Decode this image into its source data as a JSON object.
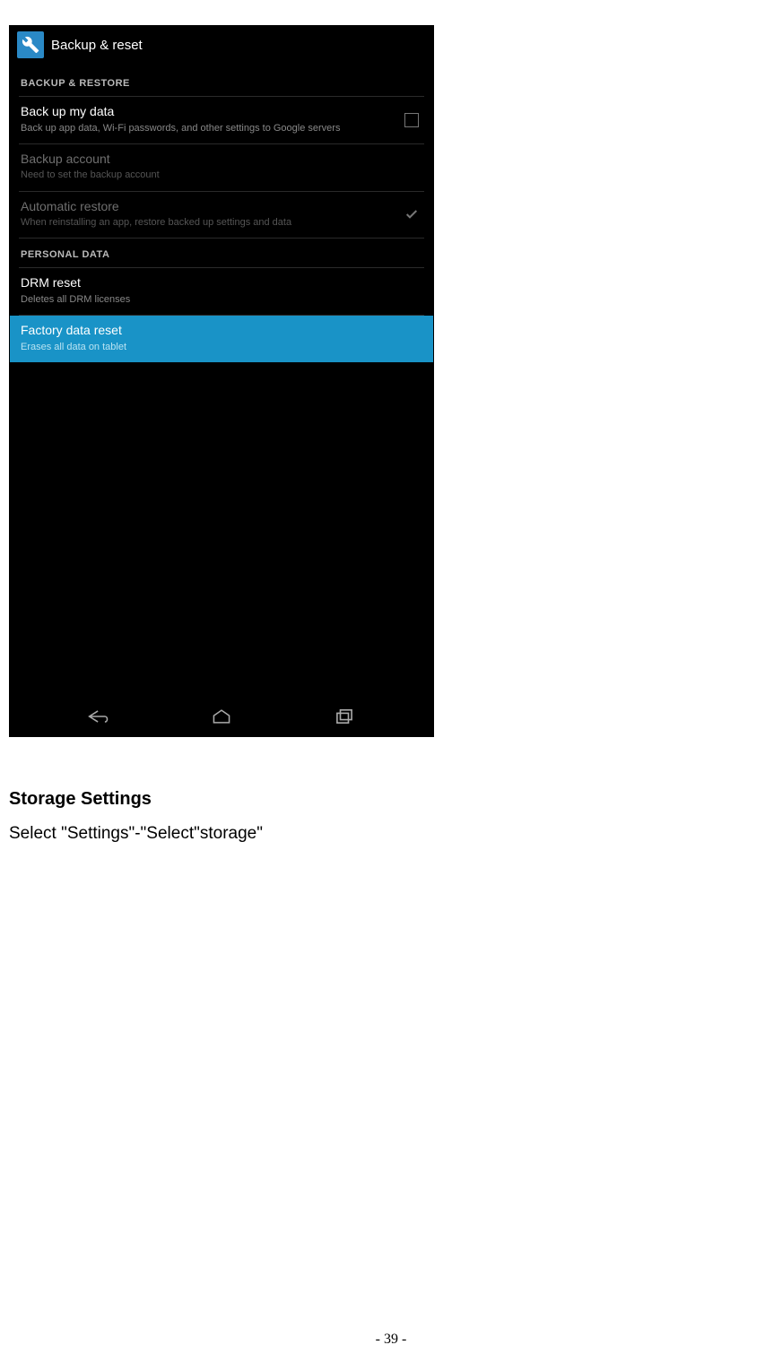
{
  "screenshot": {
    "title": "Backup & reset",
    "sections": [
      {
        "header": "BACKUP & RESTORE",
        "rows": [
          {
            "title": "Back up my data",
            "sub": "Back up app data, Wi-Fi passwords, and other settings to Google servers",
            "control": "checkbox-empty",
            "enabled": true
          },
          {
            "title": "Backup account",
            "sub": "Need to set the backup account",
            "control": "none",
            "enabled": false
          },
          {
            "title": "Automatic restore",
            "sub": "When reinstalling an app, restore backed up settings and data",
            "control": "checkmark",
            "enabled": false
          }
        ]
      },
      {
        "header": "PERSONAL DATA",
        "rows": [
          {
            "title": "DRM reset",
            "sub": "Deletes all DRM licenses",
            "control": "none",
            "enabled": true
          },
          {
            "title": "Factory data reset",
            "sub": "Erases all data on tablet",
            "control": "none",
            "enabled": true,
            "highlighted": true
          }
        ]
      }
    ]
  },
  "doc": {
    "heading": "Storage Settings",
    "text": "Select \"Settings\"-\"Select\"storage\"",
    "page_number": "- 39 -"
  }
}
